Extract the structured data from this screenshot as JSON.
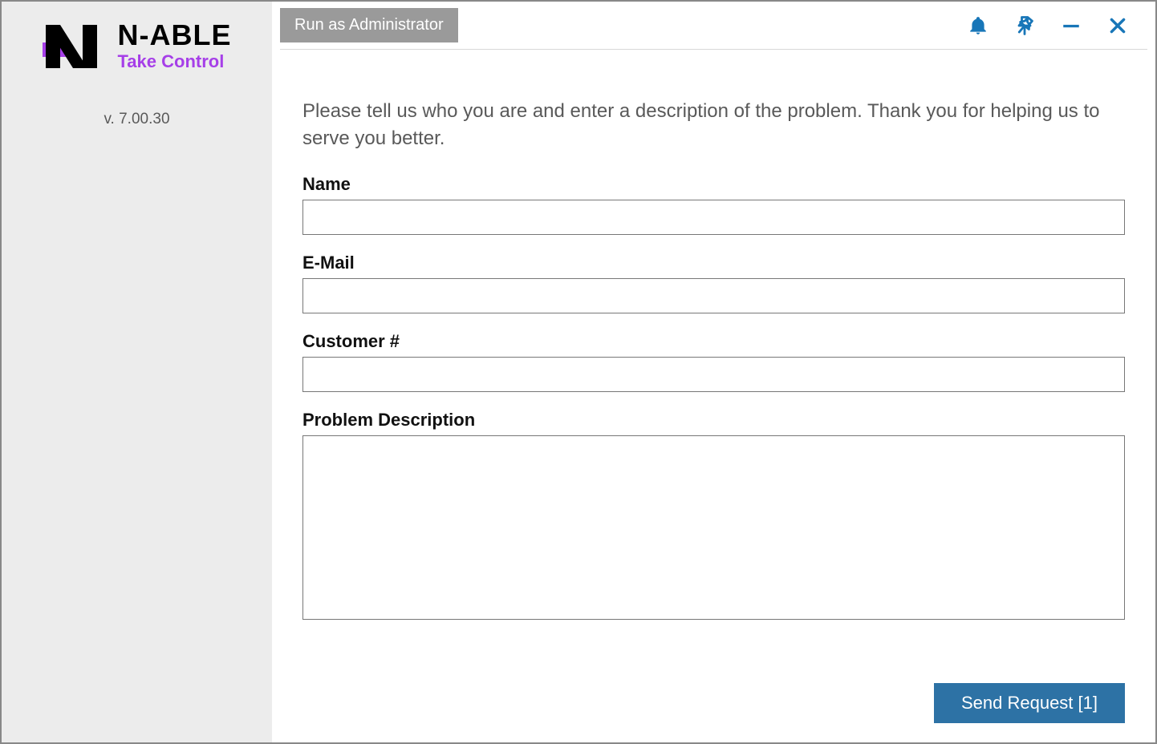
{
  "sidebar": {
    "logo_main": "N-ABLE",
    "logo_sub": "Take Control",
    "version": "v. 7.00.30"
  },
  "topbar": {
    "admin_button": "Run as Administrator"
  },
  "form": {
    "intro": "Please tell us who you are and enter a description of the problem. Thank you for helping us to serve you better.",
    "name_label": "Name",
    "name_value": "",
    "email_label": "E-Mail",
    "email_value": "",
    "customer_label": "Customer #",
    "customer_value": "",
    "problem_label": "Problem Description",
    "problem_value": ""
  },
  "footer": {
    "send_label": "Send Request [1]"
  },
  "colors": {
    "accent_blue": "#1876b8",
    "brand_purple": "#a63fe8",
    "button_blue": "#2d72a5"
  }
}
